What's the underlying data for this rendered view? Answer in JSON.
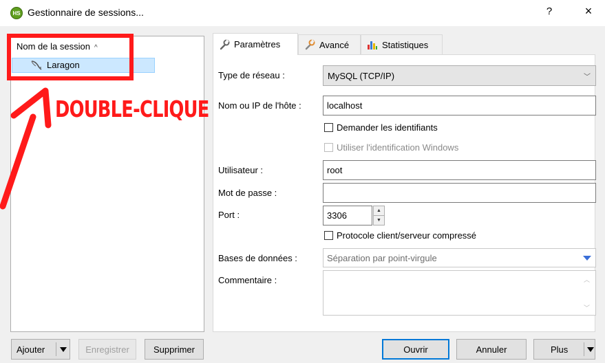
{
  "window": {
    "title": "Gestionnaire de sessions...",
    "icon_text": "HS",
    "help": "?",
    "close": "×"
  },
  "tree": {
    "header": "Nom de la session",
    "sessions": [
      {
        "name": "Laragon",
        "selected": true
      }
    ]
  },
  "annotation": {
    "text": "DOUBLE-CLIQUE",
    "color": "#ff1a1a"
  },
  "tabs": [
    {
      "label": "Paramètres",
      "icon": "wrench-icon",
      "active": true
    },
    {
      "label": "Avancé",
      "icon": "wrench-icon",
      "active": false
    },
    {
      "label": "Statistiques",
      "icon": "bar-chart-icon",
      "active": false
    }
  ],
  "settings": {
    "network_type_label": "Type de réseau :",
    "network_type_value": "MySQL (TCP/IP)",
    "host_label": "Nom ou IP de l'hôte :",
    "host_value": "localhost",
    "ask_credentials_label": "Demander les identifiants",
    "ask_credentials_checked": false,
    "windows_auth_label": "Utiliser l'identification Windows",
    "windows_auth_checked": false,
    "user_label": "Utilisateur :",
    "user_value": "root",
    "password_label": "Mot de passe :",
    "password_value": "",
    "port_label": "Port :",
    "port_value": "3306",
    "compressed_label": "Protocole client/serveur compressé",
    "compressed_checked": false,
    "databases_label": "Bases de données :",
    "databases_placeholder": "Séparation par point-virgule",
    "comment_label": "Commentaire :",
    "comment_value": ""
  },
  "buttons": {
    "add": "Ajouter",
    "save": "Enregistrer",
    "delete": "Supprimer",
    "open": "Ouvrir",
    "cancel": "Annuler",
    "more": "Plus"
  },
  "colors": {
    "selection": "#cce8ff",
    "primary_border": "#0078d7",
    "panel_bg": "#f0f0f0"
  }
}
